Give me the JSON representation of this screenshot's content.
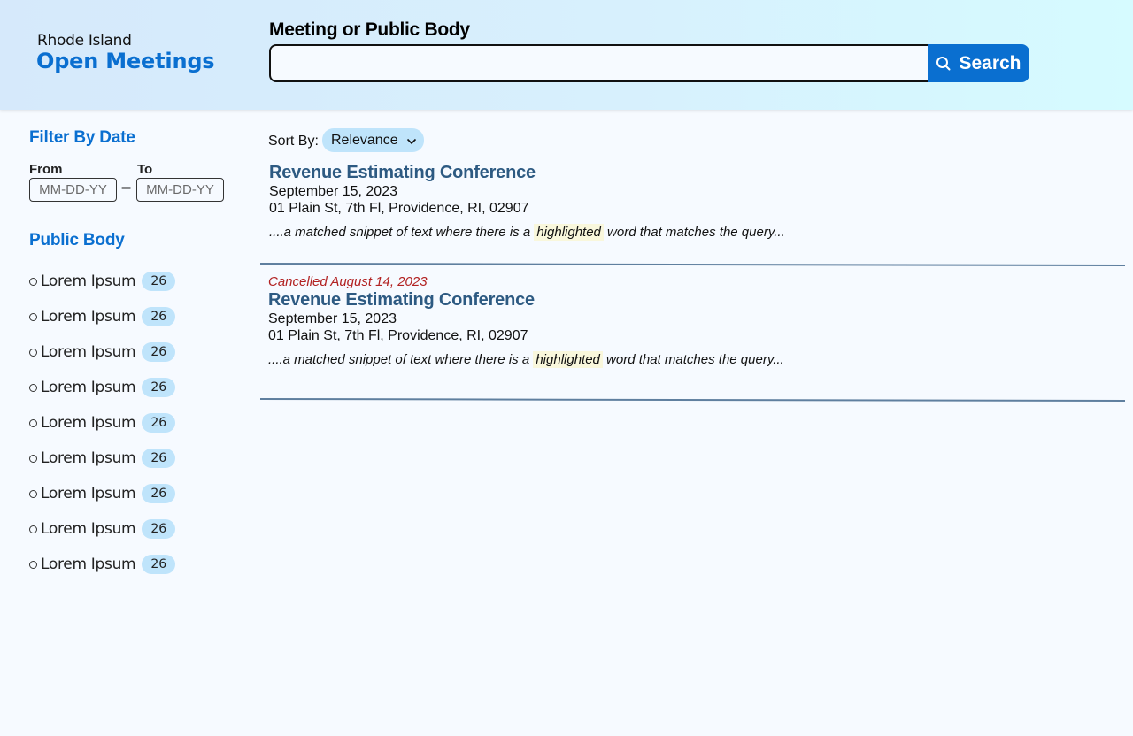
{
  "header": {
    "brand_sub": "Rhode Island",
    "brand_main": "Open Meetings",
    "search_label": "Meeting or Public Body",
    "search_value": "",
    "search_placeholder": "",
    "search_button_label": "Search",
    "search_icon": "search-icon"
  },
  "sidebar": {
    "filter_heading": "Filter By Date",
    "from_label": "From",
    "to_label": "To",
    "from_placeholder": "MM-DD-YY",
    "to_placeholder": "MM-DD-YY",
    "dash": "–",
    "public_body_heading": "Public Body",
    "public_bodies": [
      {
        "label": "Lorem Ipsum",
        "count": "26"
      },
      {
        "label": "Lorem Ipsum",
        "count": "26"
      },
      {
        "label": "Lorem Ipsum",
        "count": "26"
      },
      {
        "label": "Lorem Ipsum",
        "count": "26"
      },
      {
        "label": "Lorem Ipsum",
        "count": "26"
      },
      {
        "label": "Lorem Ipsum",
        "count": "26"
      },
      {
        "label": "Lorem Ipsum",
        "count": "26"
      },
      {
        "label": "Lorem Ipsum",
        "count": "26"
      },
      {
        "label": "Lorem Ipsum",
        "count": "26"
      }
    ]
  },
  "main": {
    "sort_label": "Sort By:",
    "sort_value": "Relevance",
    "results": [
      {
        "cancelled": "",
        "title": "Revenue Estimating Conference",
        "date": "September 15, 2023",
        "address": "01 Plain St, 7th Fl, Providence, RI, 02907",
        "snippet_before": "....a matched snippet of text where there is a ",
        "snippet_highlight": "highlighted",
        "snippet_after": " word that matches the query..."
      },
      {
        "cancelled": "Cancelled August 14, 2023",
        "title": "Revenue Estimating Conference",
        "date": "September 15, 2023",
        "address": "01 Plain St, 7th Fl, Providence, RI, 02907",
        "snippet_before": "....a matched snippet of text where there is a ",
        "snippet_highlight": "highlighted",
        "snippet_after": " word that matches the query..."
      }
    ]
  },
  "colors": {
    "brand_blue": "#0a6fd0",
    "title_blue": "#2d5a82",
    "cancelled_red": "#b22222",
    "badge_bg": "#bfe4fb",
    "highlight_bg": "#f9f7dc",
    "divider": "#5f7f9f"
  }
}
